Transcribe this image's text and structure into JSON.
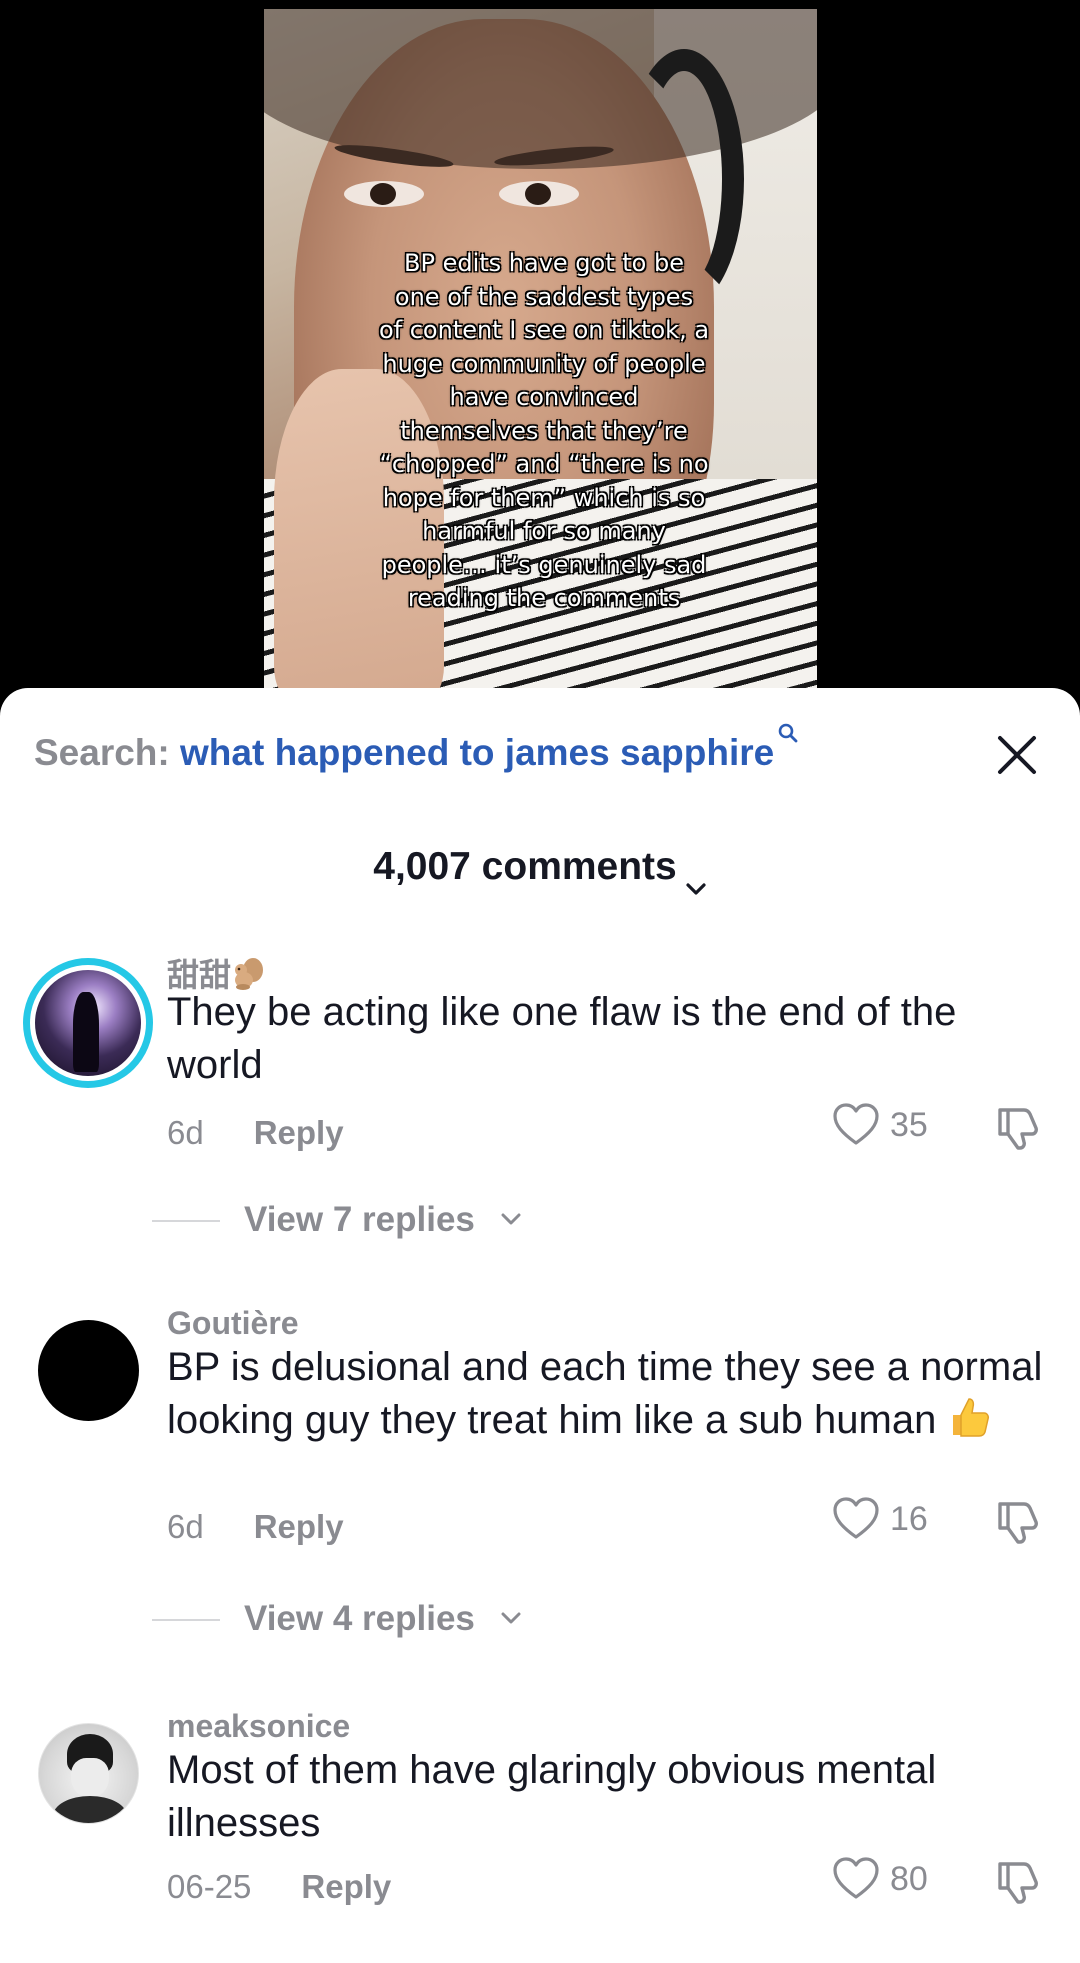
{
  "video": {
    "overlay_text": "BP edits have got to be\none of the saddest types\nof content I see on tiktok, a\nhuge community of people\nhave convinced\nthemselves that they’re\n“chopped” and “there is no\nhope for them” which is so\nharmful for so many\npeople… it’s genuinely sad\nreading the comments"
  },
  "search": {
    "label": "Search: ",
    "query": "what happened to james sapphire"
  },
  "comments_header": {
    "count_label": "4,007 comments"
  },
  "comments": [
    {
      "username": "甜甜",
      "text": "They be acting like one flaw is the end of the world",
      "age": "6d",
      "reply_label": "Reply",
      "likes": "35",
      "view_replies": "View 7 replies"
    },
    {
      "username": "Goutière",
      "text": "BP is delusional and each time they see a normal looking guy they treat him like a sub human",
      "age": "6d",
      "reply_label": "Reply",
      "likes": "16",
      "view_replies": "View 4 replies"
    },
    {
      "username": "meaksonice",
      "text": "Most of them have glaringly obvious mental illnesses",
      "age": "06-25",
      "reply_label": "Reply",
      "likes": "80"
    }
  ],
  "colors": {
    "accent_link": "#2b5cb5",
    "muted_text": "#8a8b91",
    "primary_text": "#161823",
    "story_ring": "#25c8e6"
  }
}
